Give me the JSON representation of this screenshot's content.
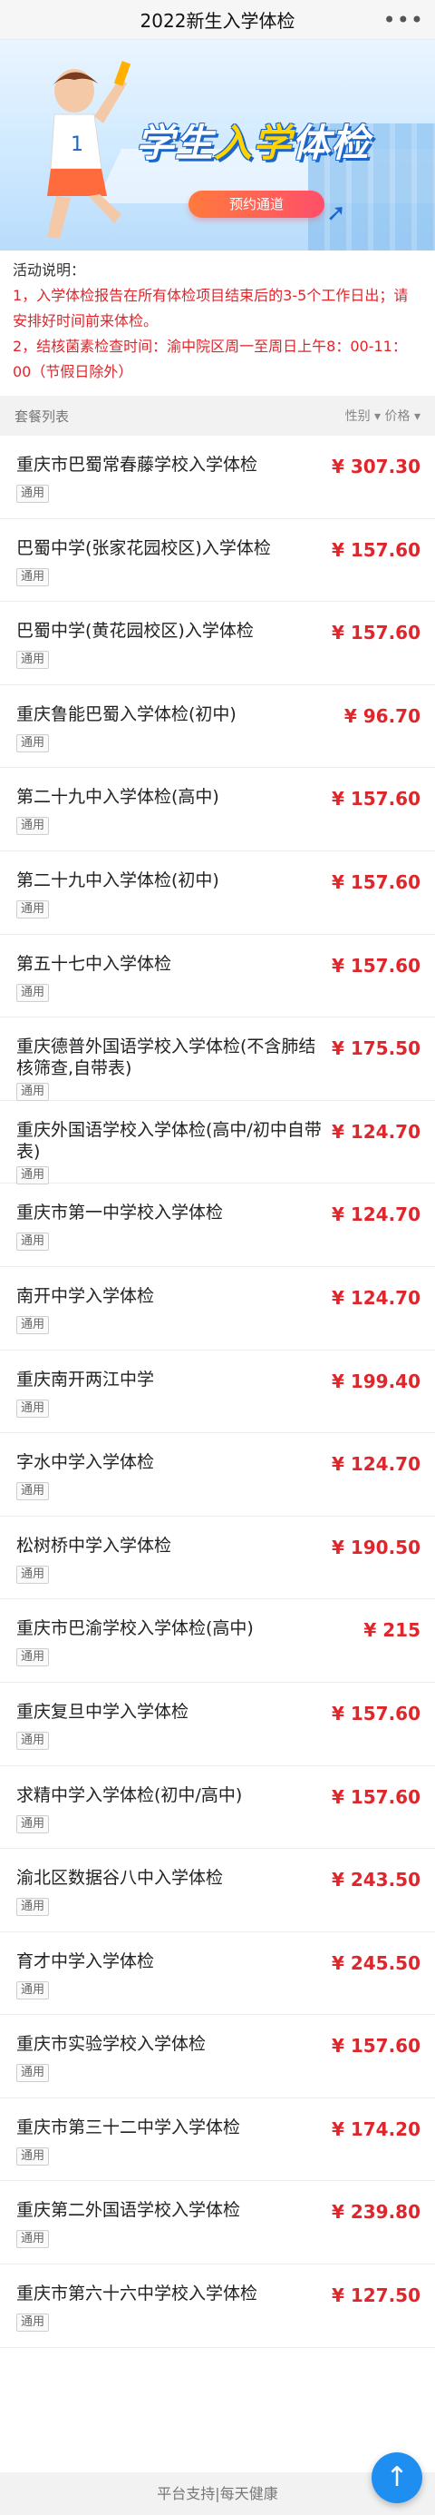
{
  "header": {
    "title": "2022新生入学体检",
    "more_icon": "more-dots-icon"
  },
  "banner": {
    "headline_part1": "学生",
    "headline_accent": "入学",
    "headline_part2": "体检",
    "cta_label": "预约通道",
    "runner_number": "1"
  },
  "notice": {
    "title": "活动说明：",
    "lines": [
      "1，入学体检报告在所有体检项目结束后的3-5个工作日出；请安排好时间前来体检。",
      "2，结核菌素检查时间：渝中院区周一至周日上午8：00-11：00（节假日除外）"
    ]
  },
  "list_header": {
    "left": "套餐列表",
    "right": "性别 ▾ 价格 ▾"
  },
  "items": [
    {
      "name": "重庆市巴蜀常春藤学校入学体检",
      "tag": "通用",
      "price": "¥ 307.30"
    },
    {
      "name": "巴蜀中学(张家花园校区)入学体检",
      "tag": "通用",
      "price": "¥ 157.60"
    },
    {
      "name": "巴蜀中学(黄花园校区)入学体检",
      "tag": "通用",
      "price": "¥ 157.60"
    },
    {
      "name": "重庆鲁能巴蜀入学体检(初中)",
      "tag": "通用",
      "price": "¥ 96.70"
    },
    {
      "name": "第二十九中入学体检(高中)",
      "tag": "通用",
      "price": "¥ 157.60"
    },
    {
      "name": "第二十九中入学体检(初中)",
      "tag": "通用",
      "price": "¥ 157.60"
    },
    {
      "name": "第五十七中入学体检",
      "tag": "通用",
      "price": "¥ 157.60"
    },
    {
      "name": "重庆德普外国语学校入学体检(不含肺结核筛查,自带表)",
      "tag": "通用",
      "price": "¥ 175.50"
    },
    {
      "name": "重庆外国语学校入学体检(高中/初中自带表)",
      "tag": "通用",
      "price": "¥ 124.70"
    },
    {
      "name": "重庆市第一中学校入学体检",
      "tag": "通用",
      "price": "¥ 124.70"
    },
    {
      "name": "南开中学入学体检",
      "tag": "通用",
      "price": "¥ 124.70"
    },
    {
      "name": "重庆南开两江中学",
      "tag": "通用",
      "price": "¥ 199.40"
    },
    {
      "name": "字水中学入学体检",
      "tag": "通用",
      "price": "¥ 124.70"
    },
    {
      "name": "松树桥中学入学体检",
      "tag": "通用",
      "price": "¥ 190.50"
    },
    {
      "name": "重庆市巴渝学校入学体检(高中)",
      "tag": "通用",
      "price": "¥ 215"
    },
    {
      "name": "重庆复旦中学入学体检",
      "tag": "通用",
      "price": "¥ 157.60"
    },
    {
      "name": "求精中学入学体检(初中/高中)",
      "tag": "通用",
      "price": "¥ 157.60"
    },
    {
      "name": "渝北区数据谷八中入学体检",
      "tag": "通用",
      "price": "¥ 243.50"
    },
    {
      "name": "育才中学入学体检",
      "tag": "通用",
      "price": "¥ 245.50"
    },
    {
      "name": "重庆市实验学校入学体检",
      "tag": "通用",
      "price": "¥ 157.60"
    },
    {
      "name": "重庆市第三十二中学入学体检",
      "tag": "通用",
      "price": "¥ 174.20"
    },
    {
      "name": "重庆第二外国语学校入学体检",
      "tag": "通用",
      "price": "¥ 239.80"
    },
    {
      "name": "重庆市第六十六中学校入学体检",
      "tag": "通用",
      "price": "¥ 127.50"
    }
  ],
  "footer": {
    "text": "平台支持|每天健康"
  },
  "back_to_top_icon": "arrow-up-icon",
  "colors": {
    "price": "#e0252b",
    "notice": "#e0252b",
    "accent_blue": "#1f8ef1"
  }
}
